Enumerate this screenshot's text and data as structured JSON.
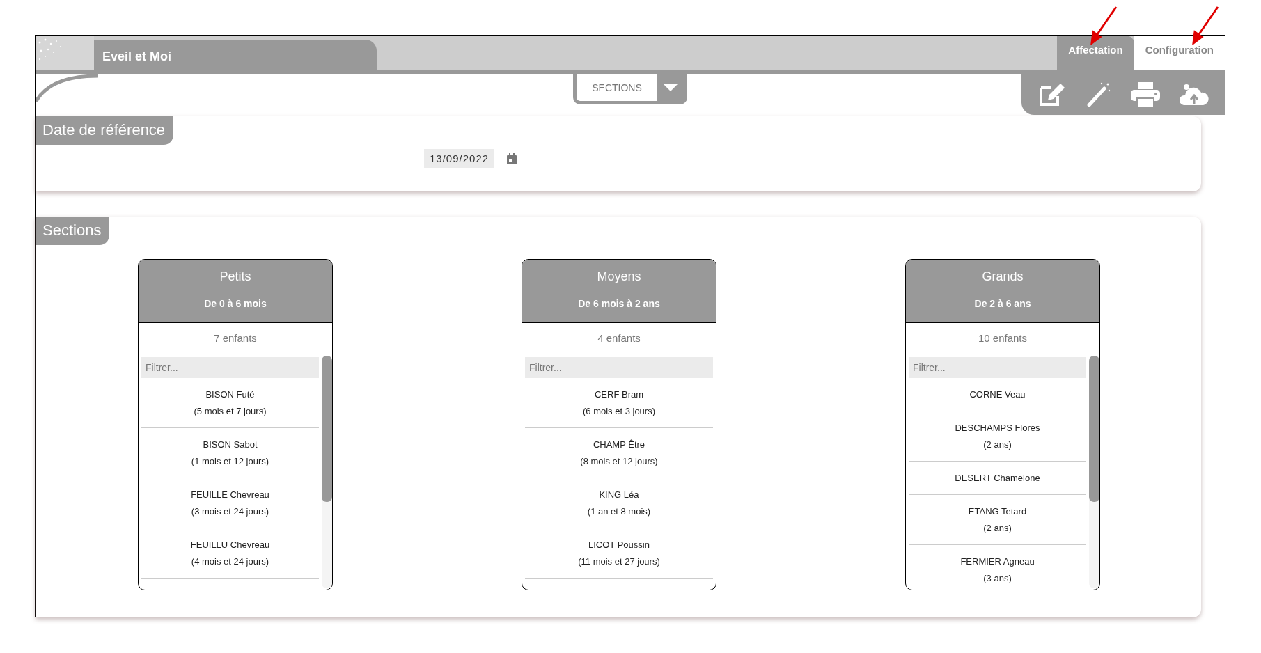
{
  "app": {
    "title": "Eveil et Moi"
  },
  "tabs": [
    {
      "label": "Affectation",
      "selected": true
    },
    {
      "label": "Configuration",
      "selected": false
    }
  ],
  "view_selector": {
    "label": "SECTIONS"
  },
  "date_panel": {
    "title": "Date de référence",
    "date": "13/09/2022"
  },
  "sections_panel": {
    "title": "Sections",
    "sections": [
      {
        "name": "Petits",
        "range": "De 0 à 6 mois",
        "count": "7 enfants",
        "filter_placeholder": "Filtrer...",
        "scrollable": true,
        "children": [
          {
            "name": "BISON Futé",
            "age": "(5 mois et 7 jours)"
          },
          {
            "name": "BISON Sabot",
            "age": "(1 mois et 12 jours)"
          },
          {
            "name": "FEUILLE Chevreau",
            "age": "(3 mois et 24 jours)"
          },
          {
            "name": "FEUILLU Chevreau",
            "age": "(4 mois et 24 jours)"
          }
        ]
      },
      {
        "name": "Moyens",
        "range": "De 6 mois à 2 ans",
        "count": "4 enfants",
        "filter_placeholder": "Filtrer...",
        "scrollable": false,
        "children": [
          {
            "name": "CERF Bram",
            "age": "(6 mois et 3 jours)"
          },
          {
            "name": "CHAMP Être",
            "age": "(8 mois et 12 jours)"
          },
          {
            "name": "KING Léa",
            "age": "(1 an et 8 mois)"
          },
          {
            "name": "LICOT Poussin",
            "age": "(11 mois et 27 jours)"
          }
        ]
      },
      {
        "name": "Grands",
        "range": "De 2 à 6 ans",
        "count": "10 enfants",
        "filter_placeholder": "Filtrer...",
        "scrollable": true,
        "children": [
          {
            "name": "CORNE Veau"
          },
          {
            "name": "DESCHAMPS Flores",
            "age": "(2 ans)"
          },
          {
            "name": "DESERT Chamelone"
          },
          {
            "name": "ETANG Tetard",
            "age": "(2 ans)"
          },
          {
            "name": "FERMIER Agneau",
            "age": "(3 ans)"
          }
        ]
      }
    ]
  }
}
